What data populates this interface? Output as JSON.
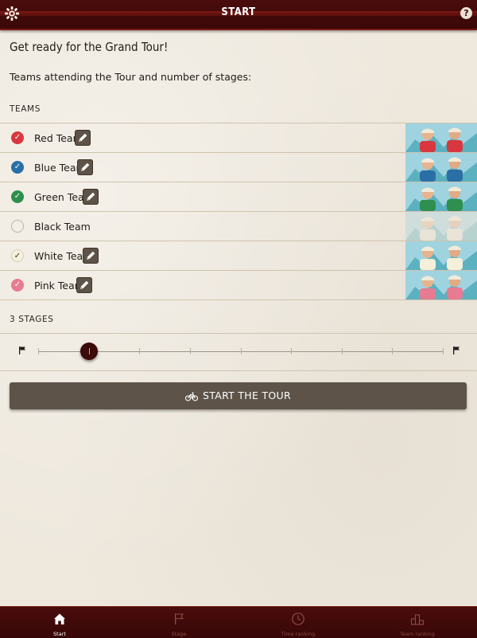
{
  "header": {
    "title": "START",
    "help_label": "?"
  },
  "intro": {
    "headline": "Get ready for the Grand Tour!",
    "subhead": "Teams attending the Tour and number of stages:"
  },
  "teams_section": {
    "label": "TEAMS",
    "items": [
      {
        "name": "Red Team",
        "selected": true,
        "color": "#d9373f",
        "editable": true
      },
      {
        "name": "Blue Team",
        "selected": true,
        "color": "#2a6fa5",
        "editable": true
      },
      {
        "name": "Green Team",
        "selected": true,
        "color": "#2f8f4e",
        "editable": true
      },
      {
        "name": "Black Team",
        "selected": false,
        "color": "#efe8dc",
        "editable": false
      },
      {
        "name": "White Team",
        "selected": true,
        "color": "#f4f0d9",
        "editable": true
      },
      {
        "name": "Pink Team",
        "selected": true,
        "color": "#e77b92",
        "editable": true
      }
    ]
  },
  "stages": {
    "label": "3 STAGES",
    "value": 3,
    "min": 1,
    "max": 21
  },
  "start_button": {
    "label": "START THE TOUR"
  },
  "tabs": [
    {
      "label": "Start",
      "active": true,
      "icon": "home-icon"
    },
    {
      "label": "Stage",
      "active": false,
      "icon": "flag-icon"
    },
    {
      "label": "Time ranking",
      "active": false,
      "icon": "clock-icon"
    },
    {
      "label": "Team ranking",
      "active": false,
      "icon": "podium-icon"
    }
  ],
  "colors": {
    "brand": "#4a0c0c",
    "button": "#5d5348",
    "paper": "#eee8dd"
  }
}
